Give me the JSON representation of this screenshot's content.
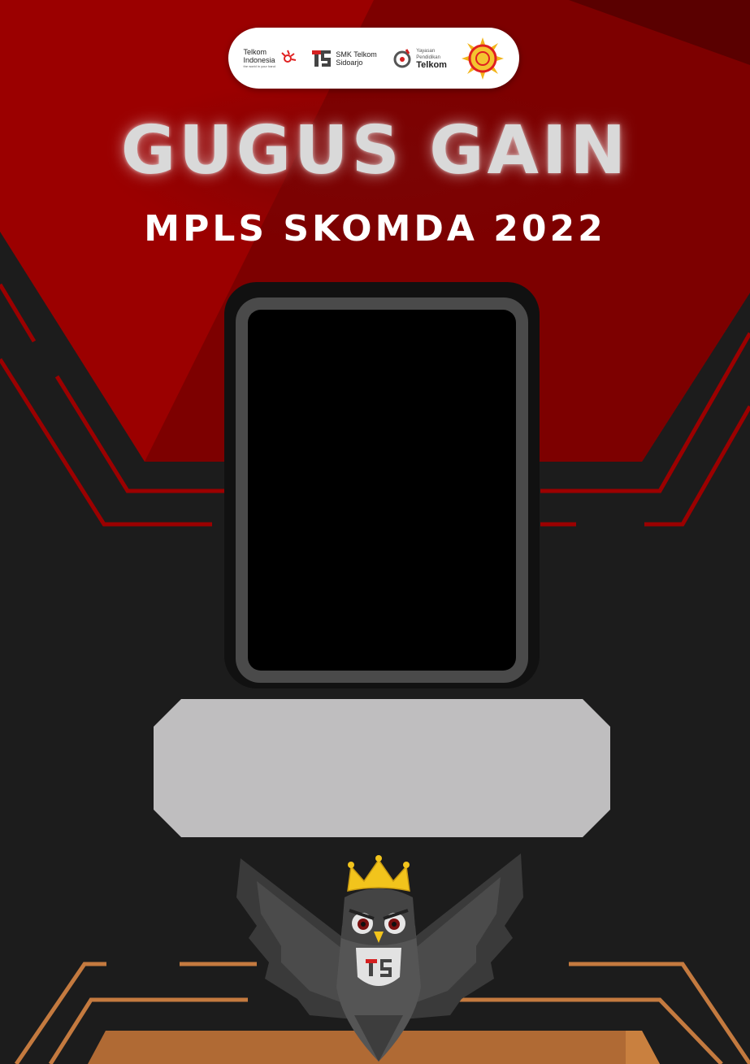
{
  "logos": {
    "telkom_indonesia": {
      "line1": "Telkom",
      "line2": "Indonesia",
      "tagline": "the world in your hand"
    },
    "smk_telkom": {
      "line1": "SMK Telkom",
      "line2": "Sidoarjo"
    },
    "yayasan": {
      "line1": "Yayasan",
      "line2": "Pendidikan",
      "line3": "Telkom"
    },
    "emblem_icon": "sun-emblem-icon"
  },
  "title": "GUGUS GAIN",
  "subtitle": "MPLS SKOMDA 2022",
  "mascot_icon": "crowned-owl-icon",
  "colors": {
    "background": "#1c1c1c",
    "red": "#9b0000",
    "dark_red": "#6b0000",
    "copper": "#c47a3f",
    "frame": "#4a4a4a",
    "name_plate": "#bfbebf",
    "crown": "#f2c41c"
  }
}
